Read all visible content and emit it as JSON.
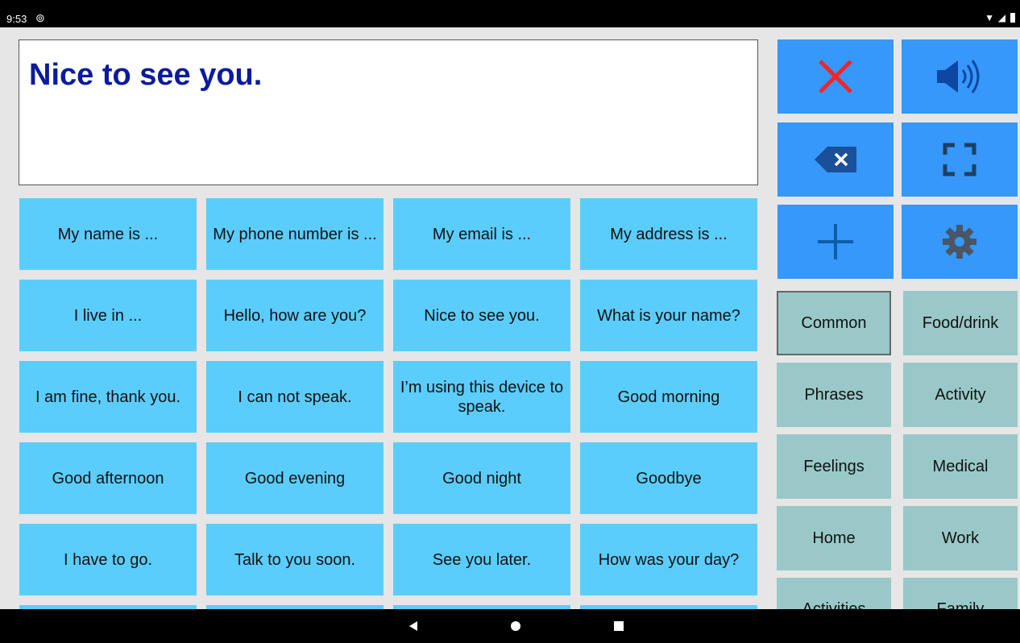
{
  "status": {
    "time": "9:53"
  },
  "message": {
    "text": "Nice to see you."
  },
  "phrases": [
    [
      "My name is ...",
      "My phone number is ...",
      "My email is ...",
      "My address is ..."
    ],
    [
      "I live in ...",
      "Hello, how are you?",
      "Nice to see you.",
      "What is your name?"
    ],
    [
      "I am fine, thank you.",
      "I can not speak.",
      "I’m using this device to speak.",
      "Good morning"
    ],
    [
      "Good afternoon",
      "Good evening",
      "Good night",
      "Goodbye"
    ],
    [
      "I have to go.",
      "Talk to you soon.",
      "See you later.",
      "How was your day?"
    ]
  ],
  "controls": [
    {
      "name": "clear-icon"
    },
    {
      "name": "speaker-icon"
    },
    {
      "name": "backspace-icon"
    },
    {
      "name": "fullscreen-icon"
    },
    {
      "name": "add-icon"
    },
    {
      "name": "settings-icon"
    }
  ],
  "categories": [
    [
      "Common",
      "Food/drink"
    ],
    [
      "Phrases",
      "Activity"
    ],
    [
      "Feelings",
      "Medical"
    ],
    [
      "Home",
      "Work"
    ],
    [
      "Activities",
      "Family"
    ]
  ],
  "selected_category": "Common",
  "colors": {
    "phrase_bg": "#5bcdfd",
    "control_bg": "#3598fa",
    "category_bg": "#9ac8c8",
    "message_text": "#0b1b9c",
    "clear_icon": "#f2252a"
  },
  "nav": {
    "icons": [
      "back-icon",
      "home-icon",
      "recents-icon"
    ]
  }
}
